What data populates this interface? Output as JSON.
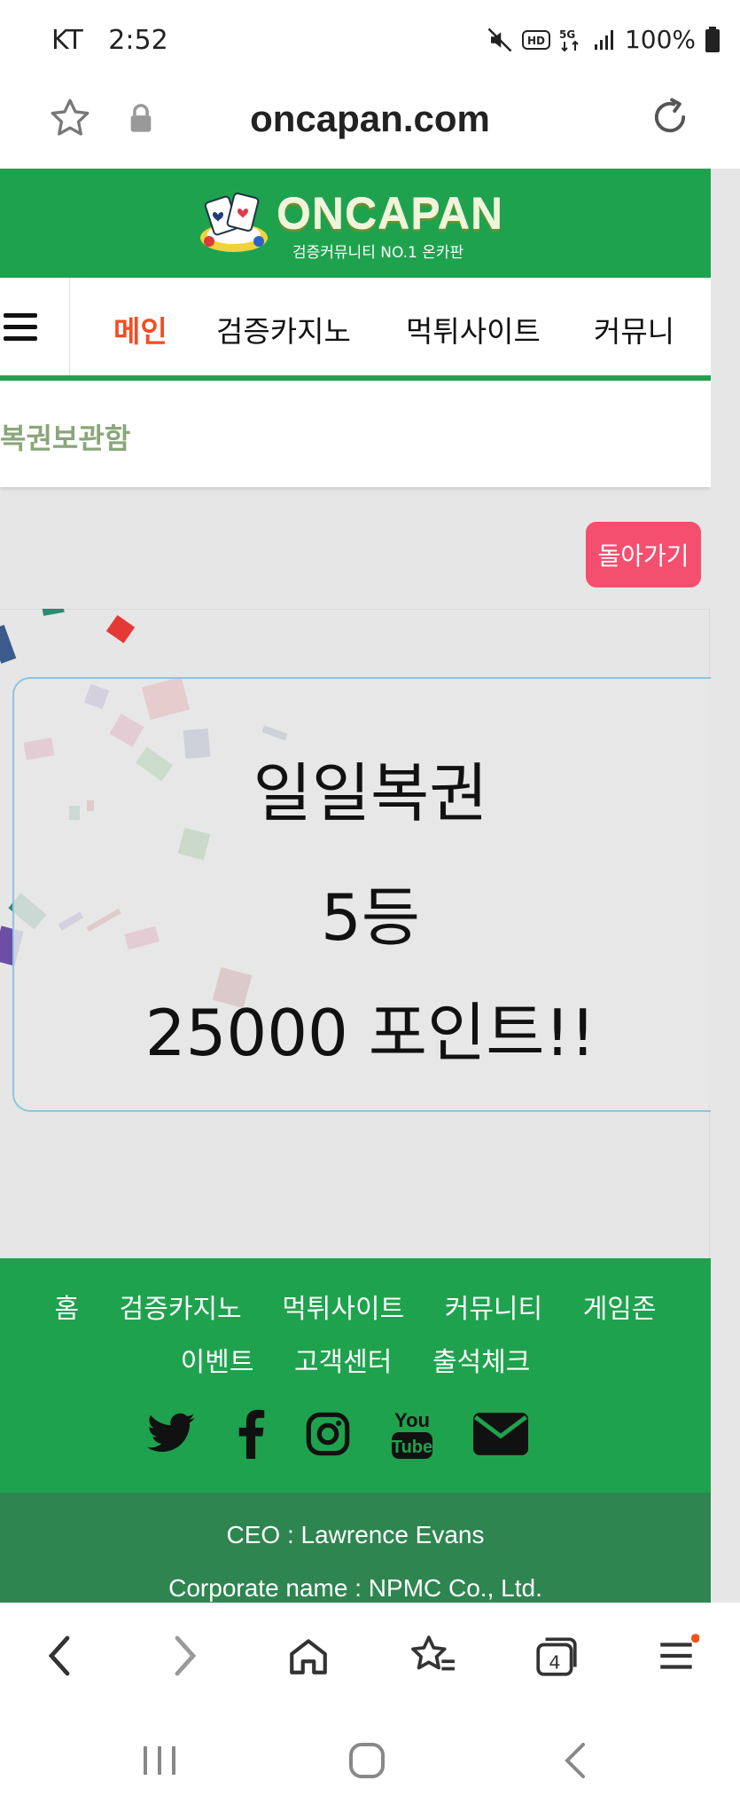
{
  "status_bar": {
    "carrier": "KT",
    "time": "2:52",
    "battery": "100%"
  },
  "browser": {
    "url": "oncapan.com",
    "tab_count": "4"
  },
  "logo": {
    "text": "ONCAPAN",
    "tagline": "검증커뮤니티 NO.1 온카판"
  },
  "nav": {
    "items": [
      "메인",
      "검증카지노",
      "먹튀사이트",
      "커뮤니"
    ],
    "active_color": "#f04e23"
  },
  "subbar": {
    "title": "복권보관함"
  },
  "back_button": {
    "label": "돌아가기"
  },
  "prize": {
    "line1": "일일복권",
    "line2": "5등",
    "line3": "25000 포인트!!"
  },
  "footer": {
    "links_row1": [
      "홈",
      "검증카지노",
      "먹튀사이트",
      "커뮤니티",
      "게임존"
    ],
    "links_row2": [
      "이벤트",
      "고객센터",
      "출석체크"
    ],
    "social": [
      "twitter-icon",
      "facebook-icon",
      "instagram-icon",
      "youtube-icon",
      "email-icon"
    ],
    "youtube_text_top": "You",
    "youtube_text_bottom": "Tube",
    "ceo": "CEO : Lawrence Evans",
    "corporate": "Corporate name : NPMC Co., Ltd."
  },
  "colors": {
    "brand_green": "#1fa24e",
    "dark_green": "#2e8550",
    "back_button": "#f44f6f"
  }
}
